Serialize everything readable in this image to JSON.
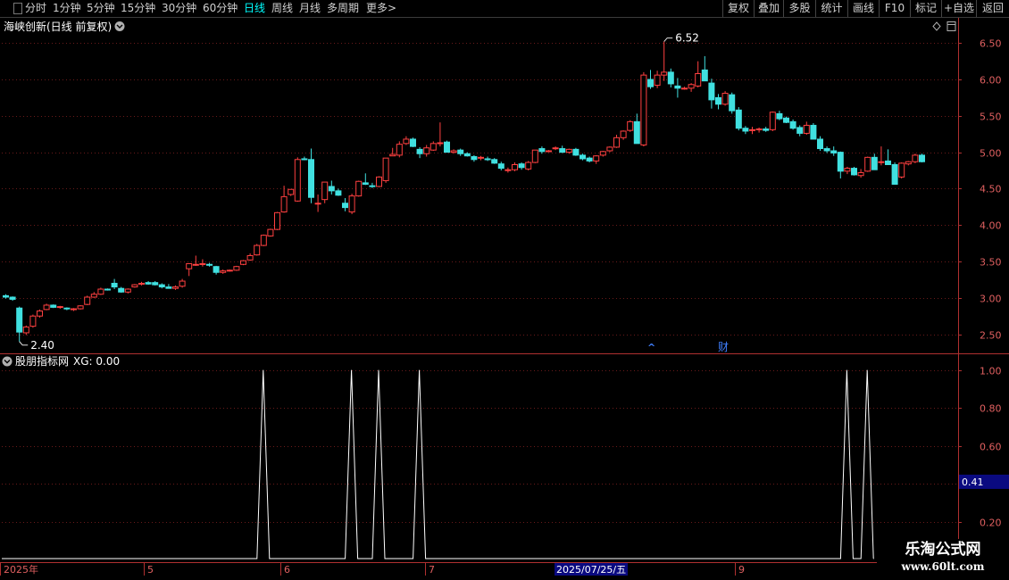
{
  "toolbar": {
    "periods": [
      "分时",
      "1分钟",
      "5分钟",
      "15分钟",
      "30分钟",
      "60分钟",
      "日线",
      "周线",
      "月线",
      "多周期",
      "更多"
    ],
    "more_arrow": ">",
    "active_period": "日线",
    "right_buttons": [
      "复权",
      "叠加",
      "多股",
      "统计",
      "画线",
      "F10",
      "标记",
      "+自选",
      "返回"
    ]
  },
  "main_panel": {
    "title": "海峡创新(日线 前复权)",
    "y_ticks": [
      "6.50",
      "6.00",
      "5.50",
      "5.00",
      "4.50",
      "4.00",
      "3.50",
      "3.00",
      "2.50"
    ],
    "high_label": "6.52",
    "low_label": "2.40",
    "event_marker": "财",
    "event_arrow": "^"
  },
  "indicator_panel": {
    "title": "股朋指标网",
    "series_label": "XG: 0.00",
    "y_ticks": [
      "1.00",
      "0.80",
      "0.60",
      "0.40",
      "0.20"
    ],
    "cursor_value": "0.41"
  },
  "x_axis": {
    "labels": [
      "2025年",
      "5",
      "6",
      "7",
      "2025/07/25/五",
      "8",
      "9"
    ]
  },
  "watermark": {
    "title": "乐淘公式网",
    "url": "www.60lt.com"
  },
  "colors": {
    "up": "#ff4040",
    "down": "#40e0e0",
    "axis": "#b03030",
    "grid": "#6a1a1a",
    "active": "#00ffff"
  },
  "chart_data": [
    {
      "type": "candlestick",
      "title": "海峡创新(日线 前复权)",
      "ylim": [
        2.25,
        6.65
      ],
      "y_ticks": [
        2.5,
        3.0,
        3.5,
        4.0,
        4.5,
        5.0,
        5.5,
        6.0,
        6.5
      ],
      "x_labels": [
        "2025年",
        "5",
        "6",
        "7",
        "8",
        "9"
      ],
      "annotations": {
        "high": 6.52,
        "low": 2.4
      },
      "ohlc": [
        [
          3.03,
          3.05,
          2.99,
          3.01
        ],
        [
          3.01,
          3.02,
          2.96,
          2.98
        ],
        [
          2.86,
          2.88,
          2.4,
          2.53
        ],
        [
          2.52,
          2.62,
          2.49,
          2.6
        ],
        [
          2.61,
          2.77,
          2.59,
          2.75
        ],
        [
          2.75,
          2.84,
          2.73,
          2.82
        ],
        [
          2.84,
          2.92,
          2.83,
          2.9
        ],
        [
          2.9,
          2.91,
          2.86,
          2.87
        ],
        [
          2.87,
          2.89,
          2.85,
          2.88
        ],
        [
          2.86,
          2.87,
          2.83,
          2.85
        ],
        [
          2.84,
          2.86,
          2.82,
          2.85
        ],
        [
          2.85,
          2.9,
          2.84,
          2.89
        ],
        [
          2.91,
          3.03,
          2.9,
          3.01
        ],
        [
          3.01,
          3.08,
          3.0,
          3.05
        ],
        [
          3.05,
          3.14,
          3.04,
          3.12
        ],
        [
          3.12,
          3.13,
          3.1,
          3.11
        ],
        [
          3.2,
          3.26,
          3.12,
          3.15
        ],
        [
          3.13,
          3.15,
          3.07,
          3.08
        ],
        [
          3.08,
          3.13,
          3.06,
          3.12
        ],
        [
          3.15,
          3.19,
          3.14,
          3.18
        ],
        [
          3.19,
          3.22,
          3.17,
          3.2
        ],
        [
          3.21,
          3.23,
          3.18,
          3.19
        ],
        [
          3.21,
          3.23,
          3.17,
          3.18
        ],
        [
          3.18,
          3.2,
          3.13,
          3.15
        ],
        [
          3.15,
          3.19,
          3.13,
          3.13
        ],
        [
          3.13,
          3.17,
          3.11,
          3.15
        ],
        [
          3.16,
          3.26,
          3.14,
          3.23
        ],
        [
          3.4,
          3.47,
          3.3,
          3.47
        ],
        [
          3.46,
          3.58,
          3.44,
          3.46
        ],
        [
          3.46,
          3.53,
          3.43,
          3.47
        ],
        [
          3.46,
          3.48,
          3.43,
          3.45
        ],
        [
          3.43,
          3.44,
          3.32,
          3.35
        ],
        [
          3.35,
          3.39,
          3.33,
          3.37
        ],
        [
          3.37,
          3.39,
          3.36,
          3.38
        ],
        [
          3.38,
          3.44,
          3.37,
          3.43
        ],
        [
          3.46,
          3.52,
          3.45,
          3.51
        ],
        [
          3.52,
          3.61,
          3.51,
          3.58
        ],
        [
          3.59,
          3.74,
          3.58,
          3.72
        ],
        [
          3.72,
          3.87,
          3.71,
          3.86
        ],
        [
          3.85,
          3.95,
          3.84,
          3.94
        ],
        [
          3.94,
          4.18,
          3.93,
          4.17
        ],
        [
          4.18,
          4.54,
          4.17,
          4.39
        ],
        [
          4.42,
          4.49,
          4.4,
          4.49
        ],
        [
          4.33,
          4.93,
          4.32,
          4.9
        ],
        [
          4.91,
          4.94,
          4.89,
          4.9
        ],
        [
          4.9,
          5.05,
          4.3,
          4.38
        ],
        [
          4.3,
          4.42,
          4.18,
          4.3
        ],
        [
          4.35,
          4.58,
          4.3,
          4.59
        ],
        [
          4.53,
          4.61,
          4.42,
          4.47
        ],
        [
          4.47,
          4.5,
          4.4,
          4.41
        ],
        [
          4.3,
          4.37,
          4.19,
          4.24
        ],
        [
          4.18,
          4.43,
          4.15,
          4.4
        ],
        [
          4.4,
          4.61,
          4.39,
          4.6
        ],
        [
          4.58,
          4.71,
          4.55,
          4.56
        ],
        [
          4.54,
          4.58,
          4.51,
          4.53
        ],
        [
          4.53,
          4.67,
          4.52,
          4.66
        ],
        [
          4.61,
          4.92,
          4.58,
          4.92
        ],
        [
          4.95,
          5.06,
          4.96,
          4.97
        ],
        [
          4.96,
          5.15,
          4.93,
          5.11
        ],
        [
          5.12,
          5.22,
          5.1,
          5.18
        ],
        [
          5.18,
          5.2,
          5.07,
          5.08
        ],
        [
          5.04,
          5.07,
          4.92,
          4.98
        ],
        [
          4.98,
          5.1,
          4.94,
          5.06
        ],
        [
          5.03,
          5.15,
          5.02,
          5.12
        ],
        [
          5.12,
          5.41,
          5.08,
          5.13
        ],
        [
          5.14,
          5.16,
          5.0,
          5.0
        ],
        [
          5.0,
          5.04,
          4.98,
          5.02
        ],
        [
          5.03,
          5.05,
          4.95,
          4.98
        ],
        [
          4.98,
          5.0,
          4.94,
          4.95
        ],
        [
          4.94,
          4.96,
          4.87,
          4.9
        ],
        [
          4.92,
          4.95,
          4.89,
          4.93
        ],
        [
          4.91,
          4.94,
          4.88,
          4.9
        ],
        [
          4.9,
          4.92,
          4.84,
          4.85
        ],
        [
          4.84,
          4.87,
          4.75,
          4.78
        ],
        [
          4.75,
          4.79,
          4.72,
          4.76
        ],
        [
          4.76,
          4.86,
          4.74,
          4.83
        ],
        [
          4.84,
          4.86,
          4.76,
          4.79
        ],
        [
          4.77,
          4.88,
          4.75,
          4.86
        ],
        [
          4.86,
          5.03,
          4.85,
          5.03
        ],
        [
          5.05,
          5.08,
          4.98,
          5.01
        ],
        [
          5.01,
          5.03,
          5.0,
          5.02
        ],
        [
          5.05,
          5.08,
          5.03,
          5.06
        ],
        [
          5.05,
          5.09,
          4.99,
          5.0
        ],
        [
          5.0,
          5.05,
          4.98,
          5.04
        ],
        [
          5.04,
          5.06,
          4.95,
          4.96
        ],
        [
          4.96,
          4.98,
          4.89,
          4.91
        ],
        [
          4.92,
          4.94,
          4.86,
          4.88
        ],
        [
          4.88,
          4.96,
          4.84,
          4.95
        ],
        [
          4.96,
          5.02,
          4.94,
          5.01
        ],
        [
          5.02,
          5.08,
          5.0,
          5.07
        ],
        [
          5.07,
          5.24,
          5.06,
          5.2
        ],
        [
          5.2,
          5.3,
          5.17,
          5.29
        ],
        [
          5.3,
          5.44,
          5.28,
          5.42
        ],
        [
          5.42,
          5.53,
          5.4,
          5.12
        ],
        [
          5.1,
          6.1,
          5.08,
          6.06
        ],
        [
          6.0,
          6.13,
          5.87,
          5.9
        ],
        [
          5.92,
          6.12,
          5.88,
          6.06
        ],
        [
          6.06,
          6.52,
          5.98,
          6.1
        ],
        [
          6.1,
          6.15,
          5.89,
          5.94
        ],
        [
          5.91,
          6.02,
          5.75,
          5.88
        ],
        [
          5.87,
          5.9,
          5.86,
          5.88
        ],
        [
          5.88,
          5.95,
          5.83,
          5.93
        ],
        [
          5.91,
          6.25,
          5.89,
          6.08
        ],
        [
          6.13,
          6.32,
          6.03,
          5.98
        ],
        [
          5.95,
          6.01,
          5.6,
          5.72
        ],
        [
          5.75,
          5.8,
          5.59,
          5.66
        ],
        [
          5.66,
          5.84,
          5.64,
          5.81
        ],
        [
          5.79,
          5.82,
          5.53,
          5.57
        ],
        [
          5.58,
          5.62,
          5.3,
          5.33
        ],
        [
          5.33,
          5.36,
          5.25,
          5.29
        ],
        [
          5.3,
          5.35,
          5.25,
          5.31
        ],
        [
          5.31,
          5.34,
          5.27,
          5.32
        ],
        [
          5.32,
          5.35,
          5.28,
          5.3
        ],
        [
          5.31,
          5.56,
          5.29,
          5.55
        ],
        [
          5.53,
          5.57,
          5.44,
          5.46
        ],
        [
          5.47,
          5.49,
          5.4,
          5.41
        ],
        [
          5.42,
          5.45,
          5.31,
          5.33
        ],
        [
          5.34,
          5.37,
          5.22,
          5.26
        ],
        [
          5.26,
          5.42,
          5.24,
          5.37
        ],
        [
          5.37,
          5.4,
          5.18,
          5.18
        ],
        [
          5.18,
          5.22,
          5.02,
          5.05
        ],
        [
          5.05,
          5.08,
          4.99,
          5.02
        ],
        [
          5.02,
          5.08,
          4.95,
          4.99
        ],
        [
          5.0,
          5.01,
          4.64,
          4.74
        ],
        [
          4.74,
          4.8,
          4.7,
          4.78
        ],
        [
          4.78,
          4.8,
          4.68,
          4.69
        ],
        [
          4.68,
          4.77,
          4.65,
          4.72
        ],
        [
          4.74,
          4.94,
          4.73,
          4.93
        ],
        [
          4.93,
          4.98,
          4.84,
          4.76
        ],
        [
          4.86,
          5.08,
          4.82,
          4.87
        ],
        [
          4.88,
          5.04,
          4.84,
          4.83
        ],
        [
          4.83,
          4.86,
          4.56,
          4.56
        ],
        [
          4.66,
          4.86,
          4.64,
          4.85
        ],
        [
          4.84,
          4.88,
          4.82,
          4.87
        ],
        [
          4.87,
          4.98,
          4.85,
          4.96
        ],
        [
          4.96,
          4.98,
          4.86,
          4.87
        ]
      ]
    },
    {
      "type": "line",
      "title": "股朋指标网",
      "series": [
        {
          "name": "XG",
          "last_value": 0.0,
          "pulse_value": 1.0,
          "pulse_indices": [
            38,
            51,
            55,
            61,
            124,
            127
          ]
        }
      ],
      "ylim": [
        0.0,
        1.05
      ],
      "y_ticks": [
        0.2,
        0.4,
        0.6,
        0.8,
        1.0
      ]
    }
  ]
}
